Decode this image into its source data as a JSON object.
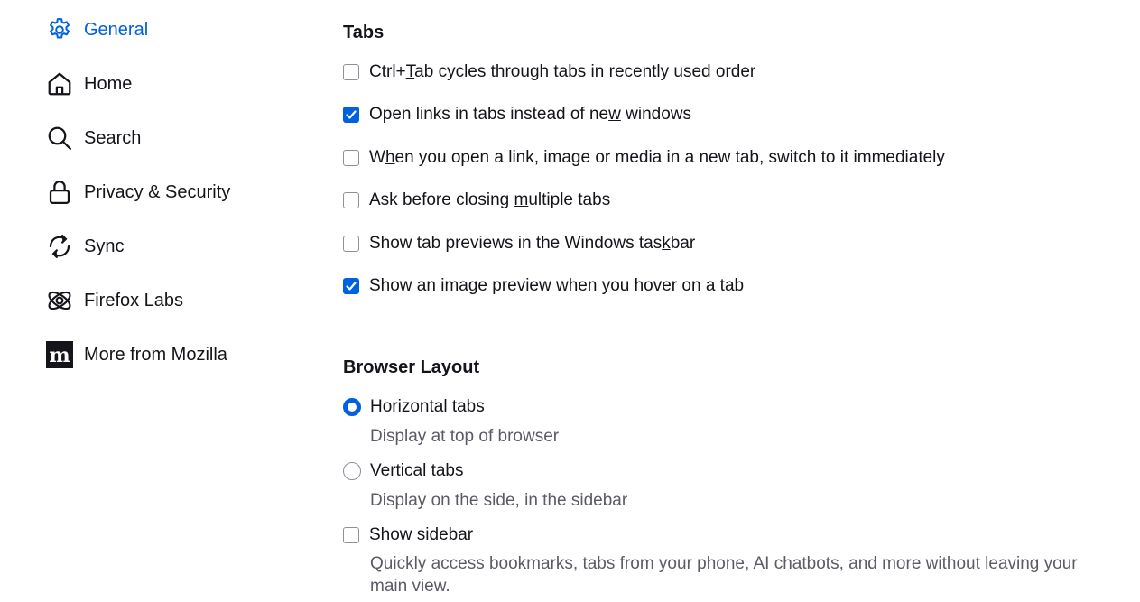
{
  "sidebar": {
    "items": [
      {
        "label": "General",
        "icon": "gear-icon",
        "active": true
      },
      {
        "label": "Home",
        "icon": "home-icon",
        "active": false
      },
      {
        "label": "Search",
        "icon": "search-icon",
        "active": false
      },
      {
        "label": "Privacy & Security",
        "icon": "lock-icon",
        "active": false
      },
      {
        "label": "Sync",
        "icon": "sync-icon",
        "active": false
      },
      {
        "label": "Firefox Labs",
        "icon": "atom-icon",
        "active": false
      },
      {
        "label": "More from Mozilla",
        "icon": "mozilla-logo-icon",
        "active": false
      }
    ]
  },
  "tabs_section": {
    "title": "Tabs",
    "options": [
      {
        "pre": "Ctrl+",
        "key": "T",
        "post": "ab cycles through tabs in recently used order",
        "checked": false
      },
      {
        "pre": "Open links in tabs instead of ne",
        "key": "w",
        "post": " windows",
        "checked": true
      },
      {
        "pre": "W",
        "key": "h",
        "post": "en you open a link, image or media in a new tab, switch to it immediately",
        "checked": false
      },
      {
        "pre": "Ask before closing ",
        "key": "m",
        "post": "ultiple tabs",
        "checked": false
      },
      {
        "pre": "Show tab previews in the Windows tas",
        "key": "k",
        "post": "bar",
        "checked": false
      },
      {
        "pre": "Show an image preview when you hover on a tab",
        "key": "",
        "post": "",
        "checked": true
      }
    ]
  },
  "layout_section": {
    "title": "Browser Layout",
    "horizontal": {
      "label": "Horizontal tabs",
      "description": "Display at top of browser",
      "selected": true
    },
    "vertical": {
      "label": "Vertical tabs",
      "description": "Display on the side, in the sidebar",
      "selected": false
    },
    "show_sidebar": {
      "label": "Show sidebar",
      "description": "Quickly access bookmarks, tabs from your phone, AI chatbots, and more without leaving your main view.",
      "checked": false
    }
  },
  "colors": {
    "accent": "#0061e0",
    "text": "#15141a",
    "secondary_text": "#5b5b66"
  }
}
